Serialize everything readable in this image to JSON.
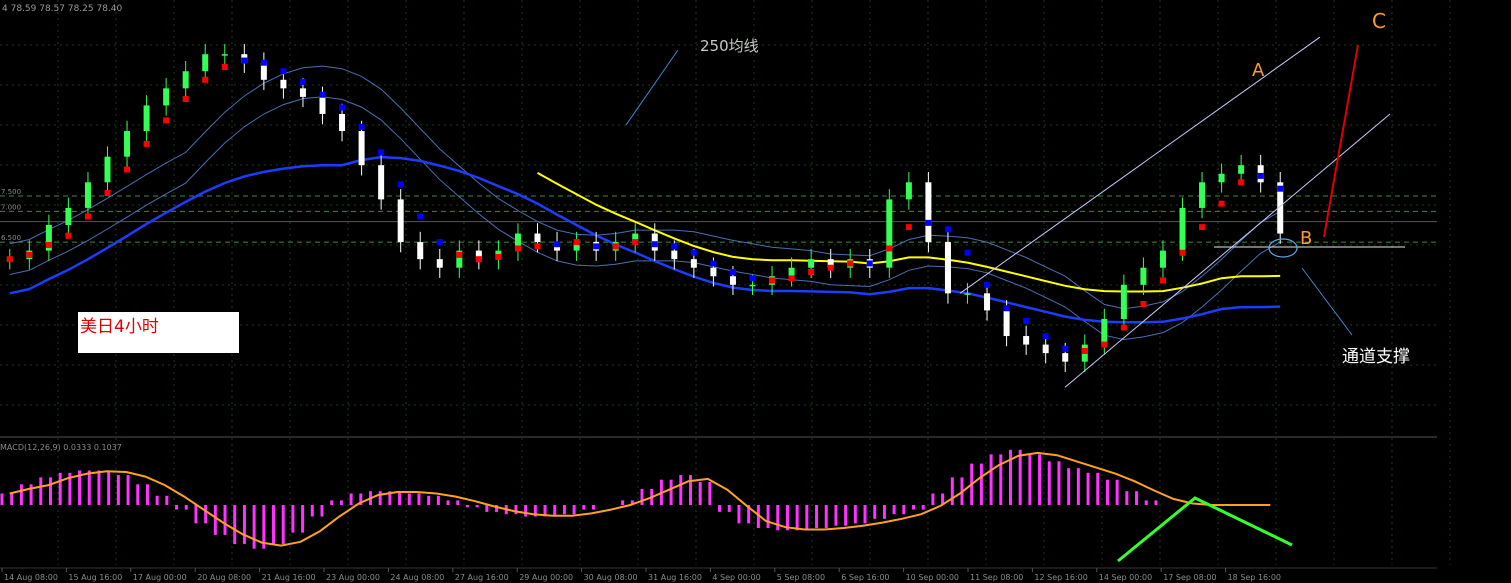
{
  "header": {
    "ohlc": "4  78.59 78.57 78.25 78.40"
  },
  "annotations": {
    "ma_label": "250均线",
    "a": "A",
    "b": "B",
    "c": "C",
    "channel_support": "通道支撑",
    "box_label": "美日4小时"
  },
  "macd": {
    "label": "MACD(12,26,9) 0.0333 0.1037"
  },
  "colors": {
    "bull_candle": "#33ff55",
    "bear_candle": "#ffffff",
    "ma250": "#ffff00",
    "ma_blue": "#1e3cff",
    "envelope": "#4a6fb4",
    "channel": "#c8c8ff",
    "trend_up": "#ff0000",
    "trend_down": "#0000ff",
    "macd_hist": "#ff33ff",
    "macd_signal": "#ffa020",
    "divergence": "#33ff33",
    "grid": "#1a3d1a",
    "level_line": "#3c8c3c"
  },
  "chart_data": {
    "type": "candlestick",
    "symbol": "USDJPY",
    "timeframe": "4 hours",
    "x_tick_labels": [
      "14 Aug 08:00",
      "15 Aug 16:00",
      "17 Aug 00:00",
      "20 Aug 08:00",
      "21 Aug 16:00",
      "23 Aug 00:00",
      "24 Aug 08:00",
      "27 Aug 16:00",
      "29 Aug 00:00",
      "30 Aug 08:00",
      "31 Aug 16:00",
      "4 Sep 00:00",
      "5 Sep 08:00",
      "6 Sep 16:00",
      "10 Sep 00:00",
      "11 Sep 08:00",
      "12 Sep 16:00",
      "14 Sep 00:00",
      "17 Sep 08:00",
      "18 Sep 16:00"
    ],
    "y_axis": {
      "visible_labels": [
        "7.500",
        "7.000",
        "6.500"
      ],
      "labels_note": "right-edge price labels are cut off in the screenshot"
    },
    "closes": [
      78.25,
      78.3,
      78.45,
      78.55,
      78.7,
      78.85,
      79.0,
      79.15,
      79.25,
      79.35,
      79.45,
      79.45,
      79.4,
      79.3,
      79.25,
      79.2,
      79.1,
      79.0,
      78.8,
      78.6,
      78.35,
      78.25,
      78.2,
      78.3,
      78.25,
      78.3,
      78.4,
      78.35,
      78.3,
      78.35,
      78.3,
      78.35,
      78.4,
      78.3,
      78.25,
      78.2,
      78.15,
      78.1,
      78.1,
      78.15,
      78.2,
      78.25,
      78.2,
      78.25,
      78.2,
      78.6,
      78.7,
      78.35,
      78.05,
      78.05,
      77.95,
      77.8,
      77.75,
      77.7,
      77.65,
      77.75,
      77.9,
      78.1,
      78.2,
      78.3,
      78.55,
      78.7,
      78.75,
      78.8,
      78.7,
      78.4
    ],
    "series": [
      {
        "name": "250均线",
        "description": "yellow long-term moving average"
      },
      {
        "name": "blue moving average"
      }
    ],
    "channel": {
      "lower_left_price": 77.5,
      "lower_right_price": 78.6,
      "upper_left_price": 78.05,
      "upper_right_price": 79.05
    },
    "levels": [
      78.62,
      78.53,
      78.35
    ],
    "macd_histogram": [
      0.05,
      0.09,
      0.12,
      0.14,
      0.15,
      0.15,
      0.13,
      0.09,
      0.04,
      -0.02,
      -0.08,
      -0.13,
      -0.17,
      -0.19,
      -0.17,
      -0.12,
      -0.05,
      0.02,
      0.05,
      0.06,
      0.06,
      0.05,
      0.04,
      0.02,
      -0.01,
      -0.03,
      -0.04,
      -0.05,
      -0.05,
      -0.04,
      -0.02,
      0.0,
      0.02,
      0.07,
      0.11,
      0.13,
      0.1,
      -0.03,
      -0.08,
      -0.1,
      -0.11,
      -0.11,
      -0.1,
      -0.09,
      -0.08,
      -0.06,
      -0.04,
      -0.02,
      0.05,
      0.12,
      0.18,
      0.22,
      0.24,
      0.22,
      0.19,
      0.16,
      0.14,
      0.11,
      0.06,
      0.02,
      0.0,
      0.0,
      0.0,
      0.0,
      0.0,
      0.0
    ],
    "divergence": {
      "note": "green lines under MACD forming a peak"
    }
  }
}
